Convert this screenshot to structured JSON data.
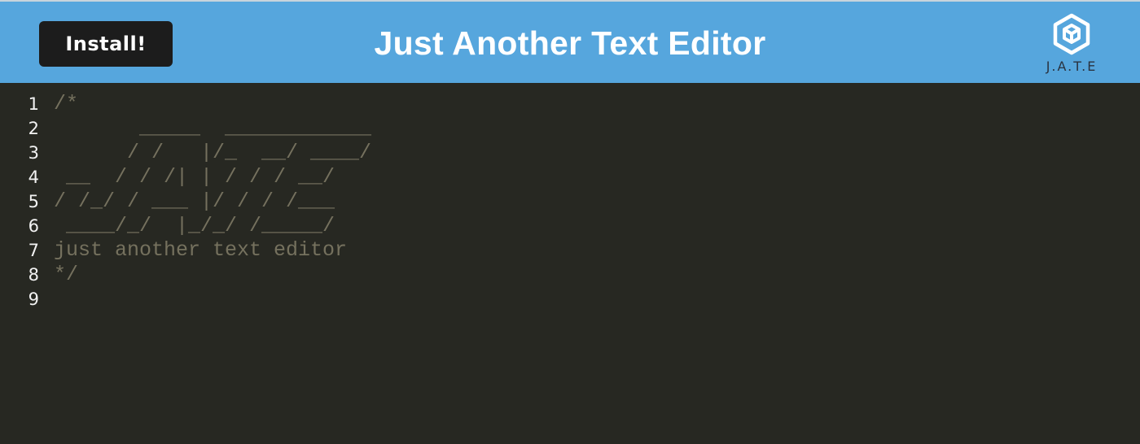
{
  "header": {
    "install_label": "Install!",
    "title": "Just Another Text Editor",
    "logo_text": "J.A.T.E",
    "logo_icon": "hexagon-cube-icon",
    "background_color": "#56a6dd"
  },
  "editor": {
    "background_color": "#272822",
    "comment_color": "#75715e",
    "lines": [
      {
        "number": "1",
        "text": "/*"
      },
      {
        "number": "2",
        "text": "       _____  ____________"
      },
      {
        "number": "3",
        "text": "      / /   |/_  __/ ____/"
      },
      {
        "number": "4",
        "text": " __  / / /| | / / / __/"
      },
      {
        "number": "5",
        "text": "/ /_/ / ___ |/ / / /___"
      },
      {
        "number": "6",
        "text": " ____/_/  |_/_/ /_____/"
      },
      {
        "number": "7",
        "text": "just another text editor"
      },
      {
        "number": "8",
        "text": "*/"
      },
      {
        "number": "9",
        "text": ""
      }
    ]
  }
}
